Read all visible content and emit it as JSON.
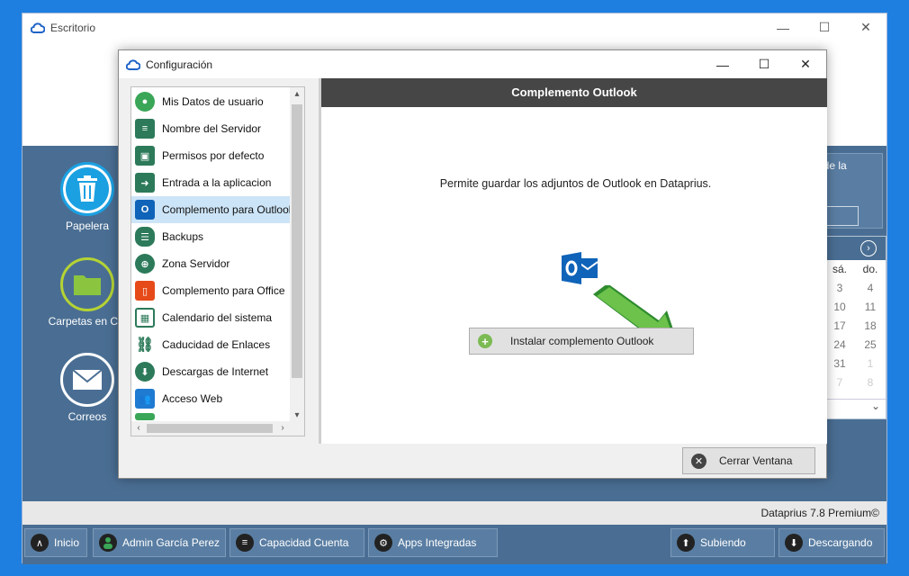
{
  "outer_window": {
    "title": "Escritorio",
    "controls": [
      "—",
      "☐",
      "✕"
    ]
  },
  "desktop": {
    "icons": [
      {
        "label": "Papelera",
        "icon": "trash-icon",
        "color": "#1ba1e2"
      },
      {
        "label": "Carpetas en Clo",
        "icon": "folder-icon",
        "color": "#8bc53f"
      },
      {
        "label": "Correos",
        "icon": "mail-icon",
        "color": "#4a6e93"
      }
    ],
    "right_panel_text": "esde la",
    "calendar": {
      "headers": [
        "sá.",
        "do."
      ],
      "rows": [
        [
          "3",
          "4"
        ],
        [
          "10",
          "11"
        ],
        [
          "17",
          "18"
        ],
        [
          "24",
          "25"
        ],
        [
          "31",
          "1"
        ],
        [
          "7",
          "8"
        ]
      ]
    }
  },
  "status": {
    "version": "Dataprius 7.8 Premium©"
  },
  "taskbar": [
    {
      "label": "Inicio",
      "icon": "up-arrow-icon"
    },
    {
      "label": "Admin García Perez",
      "icon": "user-icon"
    },
    {
      "label": "Capacidad Cuenta",
      "icon": "menu-icon"
    },
    {
      "label": "Apps Integradas",
      "icon": "gear-icon"
    },
    {
      "label": "Subiendo",
      "icon": "upload-icon"
    },
    {
      "label": "Descargando",
      "icon": "download-icon"
    }
  ],
  "dialog": {
    "title": "Configuración",
    "controls": [
      "—",
      "☐",
      "✕"
    ],
    "menu": [
      {
        "label": "Mis Datos de usuario",
        "icon": "user-icon",
        "color": "#3aa657"
      },
      {
        "label": "Nombre del Servidor",
        "icon": "server-icon",
        "color": "#2c7a5a"
      },
      {
        "label": "Permisos por defecto",
        "icon": "user-card-icon",
        "color": "#2c7a5a"
      },
      {
        "label": "Entrada a la aplicacion",
        "icon": "login-icon",
        "color": "#2c7a5a"
      },
      {
        "label": "Complemento para Outlook",
        "icon": "outlook-icon",
        "color": "#0f63b8"
      },
      {
        "label": "Backups",
        "icon": "database-icon",
        "color": "#2c7a5a"
      },
      {
        "label": "Zona Servidor",
        "icon": "globe-icon",
        "color": "#2c7a5a"
      },
      {
        "label": "Complemento para Office",
        "icon": "office-icon",
        "color": "#e64a19"
      },
      {
        "label": "Calendario del sistema",
        "icon": "calendar-icon",
        "color": "#2c7a5a"
      },
      {
        "label": "Caducidad de Enlaces",
        "icon": "link-icon",
        "color": "#2c7a5a"
      },
      {
        "label": "Descargas de Internet",
        "icon": "download-icon",
        "color": "#2c7a5a"
      },
      {
        "label": "Acceso Web",
        "icon": "web-users-icon",
        "color": "#1f7bd1"
      }
    ],
    "selected_index": 4,
    "content": {
      "header": "Complemento Outlook",
      "description": "Permite guardar los adjuntos de Outlook en Dataprius.",
      "install_button": "Instalar complemento Outlook"
    },
    "close_button": "Cerrar Ventana"
  }
}
